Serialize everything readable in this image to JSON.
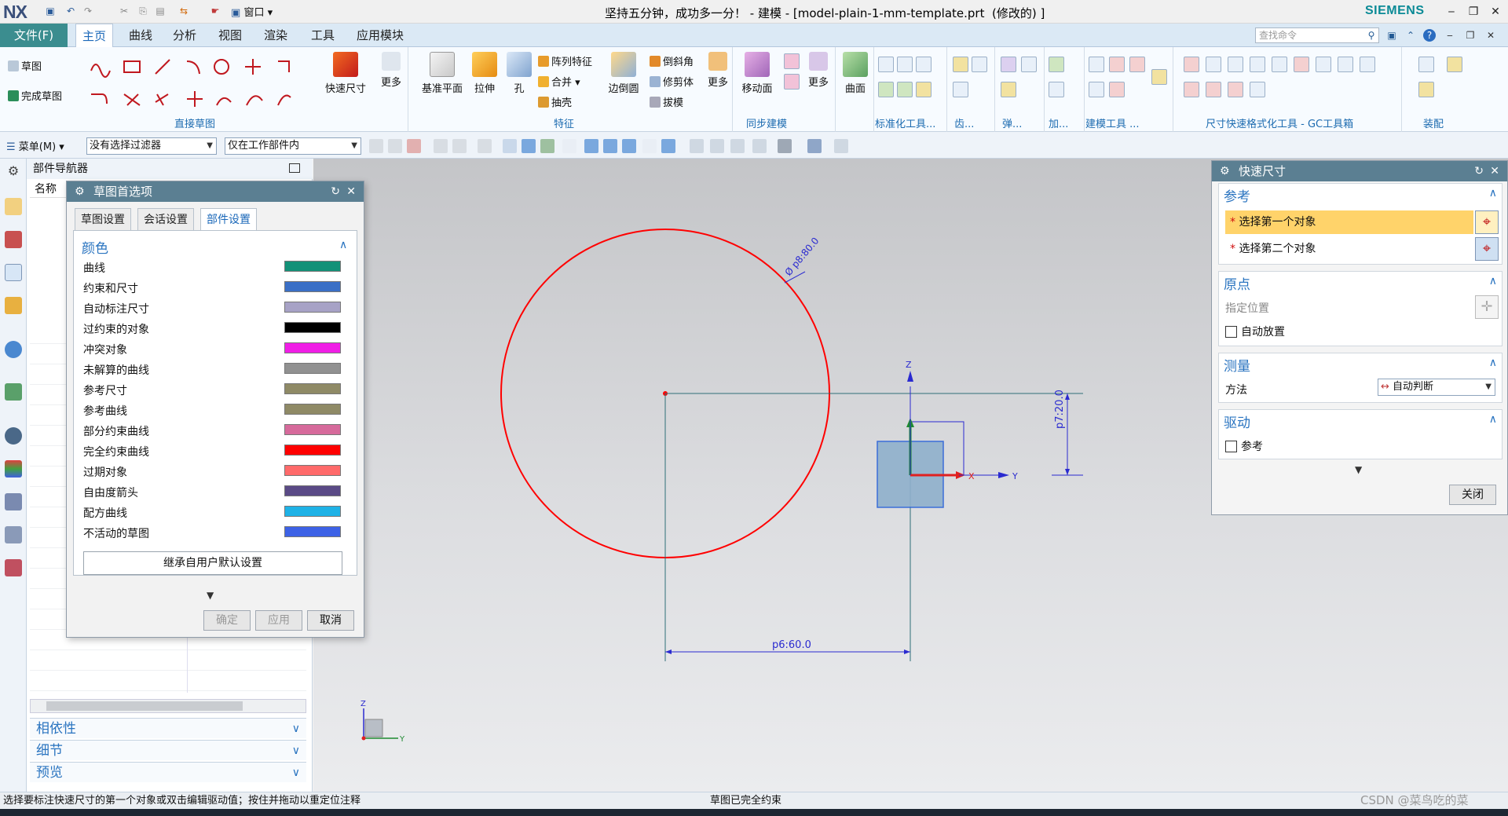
{
  "window": {
    "logo": "NX",
    "title": "坚持五分钟，成功多一分！ - 建模 - [model-plain-1-mm-template.prt  (修改的) ]",
    "brand": "SIEMENS",
    "quick_window_label": "窗口"
  },
  "menubar": {
    "file_label": "文件(F)",
    "tabs": [
      "主页",
      "曲线",
      "分析",
      "视图",
      "渲染",
      "工具",
      "应用模块"
    ],
    "search_placeholder": "查找命令"
  },
  "ribbon": {
    "sketch_label": "草图",
    "finish_sketch_label": "完成草图",
    "direct_sketch_group": "直接草图",
    "quick_dim_label": "快速尺寸",
    "more_label": "更多",
    "datum_plane_label": "基准平面",
    "extrude_label": "拉伸",
    "hole_label": "孔",
    "pattern_feature_label": "阵列特征",
    "unite_label": "合并",
    "shell_label": "抽壳",
    "edge_blend_label": "边倒圆",
    "chamfer_label": "倒斜角",
    "trim_body_label": "修剪体",
    "draft_label": "拔模",
    "feature_group": "特征",
    "move_face_label": "移动面",
    "sync_group": "同步建模",
    "surface_label": "曲面",
    "std_tools_group": "标准化工具...",
    "gear_group": "齿...",
    "spring_group": "弹...",
    "add_group": "加...",
    "modeling_tools_group": "建模工具 ...",
    "dim_format_group": "尺寸快速格式化工具 - GC工具箱",
    "assembly_group": "装配"
  },
  "toolbar": {
    "menu_label": "菜单(M)",
    "filter_value": "没有选择过滤器",
    "scope_value": "仅在工作部件内"
  },
  "part_navigator": {
    "title": "部件导航器",
    "column_name": "名称",
    "sections": [
      "相依性",
      "细节",
      "预览"
    ]
  },
  "sketch_prefs": {
    "title": "草图首选项",
    "tabs": [
      "草图设置",
      "会话设置",
      "部件设置"
    ],
    "active_tab": 2,
    "section_title": "颜色",
    "colors": [
      {
        "label": "曲线",
        "color": "#129178"
      },
      {
        "label": "约束和尺寸",
        "color": "#3a6fc6"
      },
      {
        "label": "自动标注尺寸",
        "color": "#a7a2c6"
      },
      {
        "label": "过约束的对象",
        "color": "#000000"
      },
      {
        "label": "冲突对象",
        "color": "#f01ee6"
      },
      {
        "label": "未解算的曲线",
        "color": "#919191"
      },
      {
        "label": "参考尺寸",
        "color": "#8f8a66"
      },
      {
        "label": "参考曲线",
        "color": "#8f8a66"
      },
      {
        "label": "部分约束曲线",
        "color": "#d66a9b"
      },
      {
        "label": "完全约束曲线",
        "color": "#ff0000"
      },
      {
        "label": "过期对象",
        "color": "#ff6a6a"
      },
      {
        "label": "自由度箭头",
        "color": "#5a4a86"
      },
      {
        "label": "配方曲线",
        "color": "#1fb2e6"
      },
      {
        "label": "不活动的草图",
        "color": "#3d62e6"
      }
    ],
    "inherit_label": "继承自用户默认设置",
    "ok_label": "确定",
    "apply_label": "应用",
    "cancel_label": "取消"
  },
  "quick_dim": {
    "title": "快速尺寸",
    "reference": {
      "title": "参考",
      "first": "选择第一个对象",
      "second": "选择第二个对象"
    },
    "origin": {
      "title": "原点",
      "specify": "指定位置",
      "auto_place": "自动放置"
    },
    "measure": {
      "title": "测量",
      "method_label": "方法",
      "method_value": "自动判断"
    },
    "driving": {
      "title": "驱动",
      "reference": "参考"
    },
    "close_label": "关闭"
  },
  "canvas": {
    "circle_dim": "Ø p8:80.0",
    "horiz_dim": "p6:60.0",
    "vert_dim": "p7:20.0",
    "axis_x": "X",
    "axis_y": "Y",
    "axis_z": "Z",
    "colors": {
      "circle": "#ff0000",
      "dimension": "#2a2ad0",
      "cube": "#8fb0cc"
    }
  },
  "statusbar": {
    "message": "选择要标注快速尺寸的第一个对象或双击编辑驱动值；按住并拖动以重定位注释",
    "state": "草图已完全约束",
    "watermark": "CSDN @菜鸟吃的菜"
  }
}
